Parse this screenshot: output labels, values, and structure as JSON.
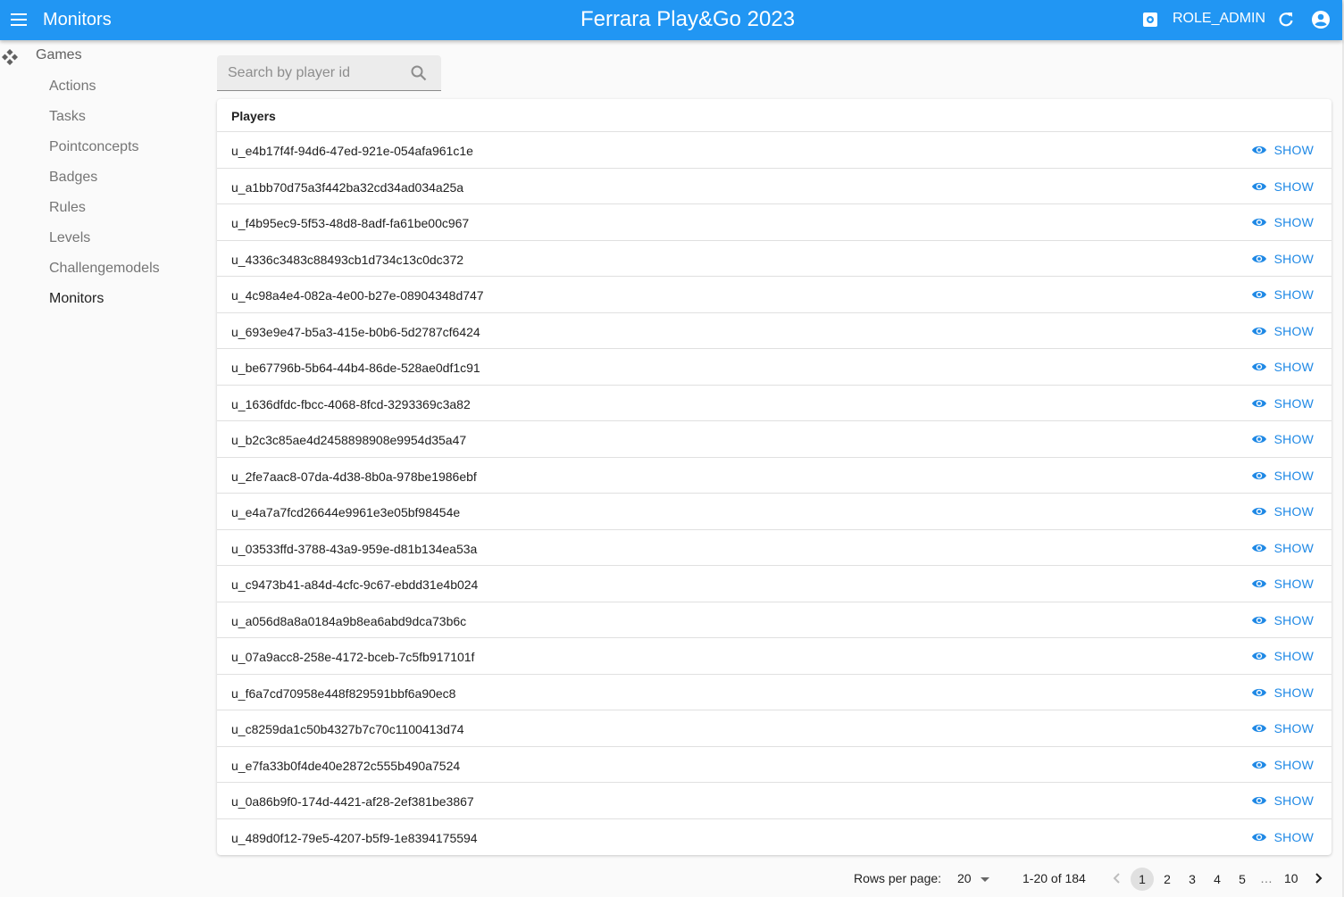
{
  "appbar": {
    "section_title": "Monitors",
    "app_title": "Ferrara Play&Go 2023",
    "role": "ROLE_ADMIN"
  },
  "sidebar": {
    "games_label": "Games",
    "items": [
      {
        "label": "Actions"
      },
      {
        "label": "Tasks"
      },
      {
        "label": "Pointconcepts"
      },
      {
        "label": "Badges"
      },
      {
        "label": "Rules"
      },
      {
        "label": "Levels"
      },
      {
        "label": "Challengemodels"
      },
      {
        "label": "Monitors"
      }
    ]
  },
  "search": {
    "placeholder": "Search by player id",
    "value": ""
  },
  "table": {
    "header": "Players",
    "show_label": "SHOW",
    "rows": [
      "u_e4b17f4f-94d6-47ed-921e-054afa961c1e",
      "u_a1bb70d75a3f442ba32cd34ad034a25a",
      "u_f4b95ec9-5f53-48d8-8adf-fa61be00c967",
      "u_4336c3483c88493cb1d734c13c0dc372",
      "u_4c98a4e4-082a-4e00-b27e-08904348d747",
      "u_693e9e47-b5a3-415e-b0b6-5d2787cf6424",
      "u_be67796b-5b64-44b4-86de-528ae0df1c91",
      "u_1636dfdc-fbcc-4068-8fcd-3293369c3a82",
      "u_b2c3c85ae4d2458898908e9954d35a47",
      "u_2fe7aac8-07da-4d38-8b0a-978be1986ebf",
      "u_e4a7a7fcd26644e9961e3e05bf98454e",
      "u_03533ffd-3788-43a9-959e-d81b134ea53a",
      "u_c9473b41-a84d-4cfc-9c67-ebdd31e4b024",
      "u_a056d8a8a0184a9b8ea6abd9dca73b6c",
      "u_07a9acc8-258e-4172-bceb-7c5fb917101f",
      "u_f6a7cd70958e448f829591bbf6a90ec8",
      "u_c8259da1c50b4327b7c70c1100413d74",
      "u_e7fa33b0f4de40e2872c555b490a7524",
      "u_0a86b9f0-174d-4421-af28-2ef381be3867",
      "u_489d0f12-79e5-4207-b5f9-1e8394175594"
    ]
  },
  "pagination": {
    "rows_per_page_label": "Rows per page:",
    "rows_per_page": "20",
    "range": "1-20 of 184",
    "pages": [
      "1",
      "2",
      "3",
      "4",
      "5"
    ],
    "current_page": "1",
    "ellipsis": "…",
    "last_page": "10"
  },
  "colors": {
    "appbar": "#2196f3",
    "accent": "#1e88e5"
  },
  "icons": {
    "menu": "menu-icon",
    "games": "gamepad-icon",
    "search": "search-icon",
    "show": "eye-icon",
    "settings": "settings-icon",
    "refresh": "refresh-icon",
    "account": "account-circle-icon",
    "prev": "chevron-left-icon",
    "next": "chevron-right-icon"
  }
}
